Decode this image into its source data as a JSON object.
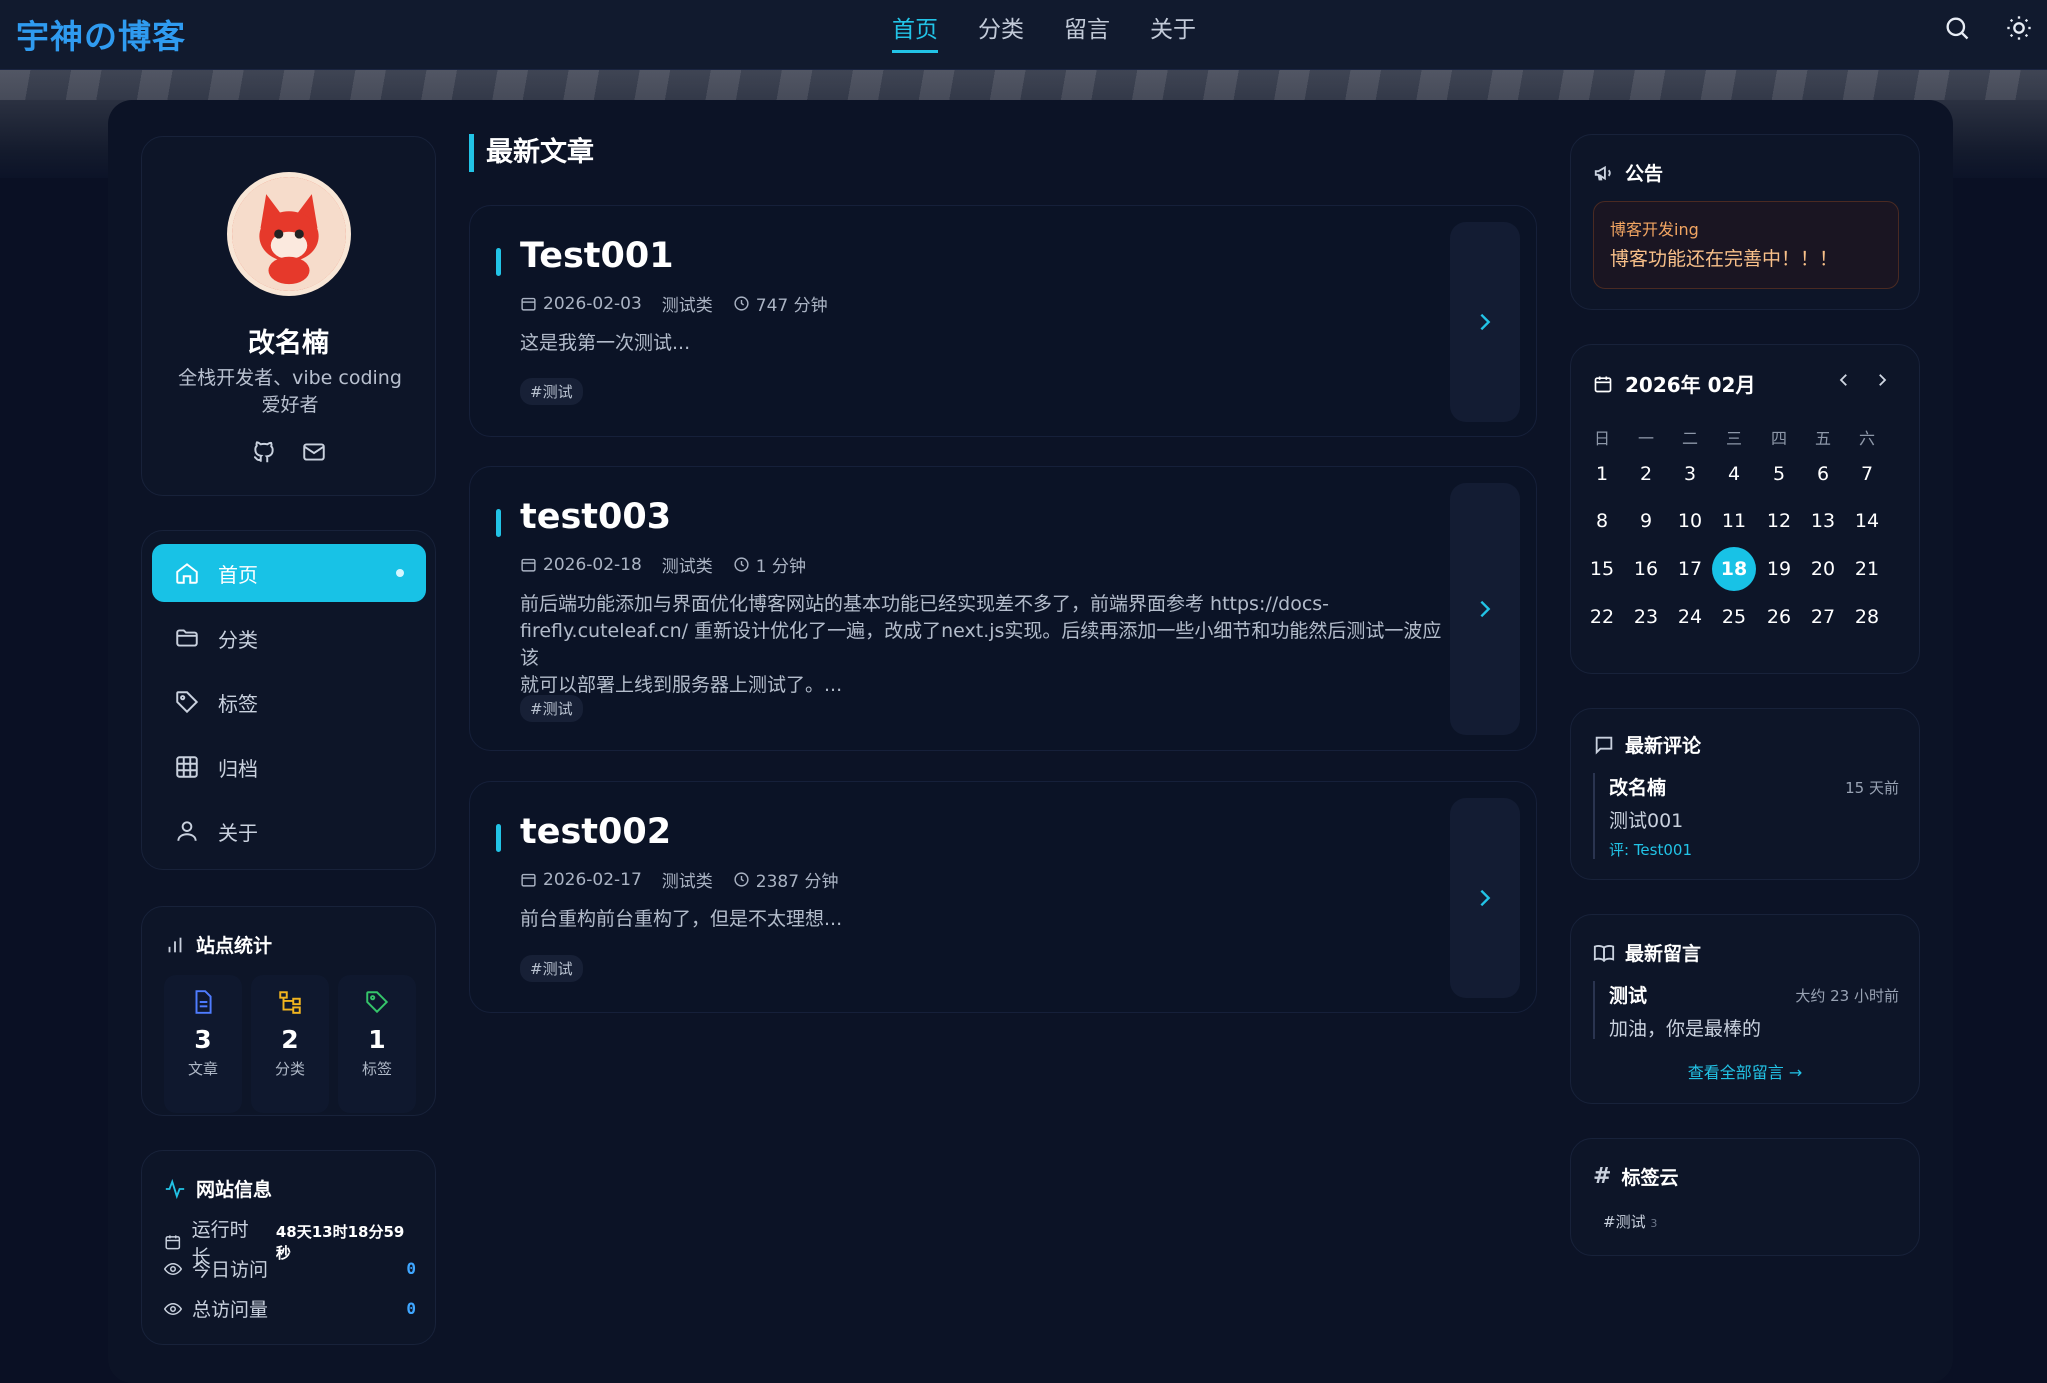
{
  "brand": {
    "logo": "宇神の博客"
  },
  "topnav": [
    {
      "label": "首页",
      "active": true
    },
    {
      "label": "分类",
      "active": false
    },
    {
      "label": "留言",
      "active": false
    },
    {
      "label": "关于",
      "active": false
    }
  ],
  "topicons": [
    "search-icon",
    "sun-icon"
  ],
  "profile": {
    "name": "改名楠",
    "bio_line1": "全栈开发者、vibe coding",
    "bio_line2": "爱好者",
    "social": [
      "github-icon",
      "mail-icon"
    ]
  },
  "sidemenu": [
    {
      "label": "首页",
      "icon": "home-icon",
      "active": true
    },
    {
      "label": "分类",
      "icon": "folder-icon",
      "active": false
    },
    {
      "label": "标签",
      "icon": "tag-icon",
      "active": false
    },
    {
      "label": "归档",
      "icon": "grid-icon",
      "active": false
    },
    {
      "label": "关于",
      "icon": "user-icon",
      "active": false
    }
  ],
  "stats": {
    "title": "站点统计",
    "items": [
      {
        "value": "3",
        "label": "文章",
        "color": "#4f7cff"
      },
      {
        "value": "2",
        "label": "分类",
        "color": "#f1b41f"
      },
      {
        "value": "1",
        "label": "标签",
        "color": "#35c46a"
      }
    ]
  },
  "siteinfo": {
    "title": "网站信息",
    "runtime_label": "运行时长",
    "runtime_value": "48天13时18分59秒",
    "today_label": "今日访问",
    "today_value": "0",
    "total_label": "总访问量",
    "total_value": "0"
  },
  "main": {
    "section_title": "最新文章",
    "posts": [
      {
        "title": "Test001",
        "date": "2026-02-03",
        "category": "测试类",
        "read": "747 分钟",
        "excerpt": "这是我第一次测试...",
        "tag": "#测试"
      },
      {
        "title": "test003",
        "date": "2026-02-18",
        "category": "测试类",
        "read": "1 分钟",
        "excerpt_line1": "前后端功能添加与界面优化博客网站的基本功能已经实现差不多了，前端界面参考 https://docs-",
        "excerpt_line2": "firefly.cuteleaf.cn/ 重新设计优化了一遍，改成了next.js实现。后续再添加一些小细节和功能然后测试一波应该",
        "excerpt_line3": "就可以部署上线到服务器上测试了。...",
        "tag": "#测试"
      },
      {
        "title": "test002",
        "date": "2026-02-17",
        "category": "测试类",
        "read": "2387 分钟",
        "excerpt": "前台重构前台重构了，但是不太理想...",
        "tag": "#测试"
      }
    ]
  },
  "notice": {
    "title": "公告",
    "line1": "博客开发ing",
    "line2": "博客功能还在完善中！！！"
  },
  "calendar": {
    "title": "2026年 02月",
    "weekdays": [
      "日",
      "一",
      "二",
      "三",
      "四",
      "五",
      "六"
    ],
    "today": "18",
    "weeks": [
      [
        "1",
        "2",
        "3",
        "4",
        "5",
        "6",
        "7"
      ],
      [
        "8",
        "9",
        "10",
        "11",
        "12",
        "13",
        "14"
      ],
      [
        "15",
        "16",
        "17",
        "18",
        "19",
        "20",
        "21"
      ],
      [
        "22",
        "23",
        "24",
        "25",
        "26",
        "27",
        "28"
      ]
    ]
  },
  "comments": {
    "title": "最新评论",
    "author": "改名楠",
    "time": "15 天前",
    "text": "测试001",
    "ref": "评: Test001"
  },
  "guestbook": {
    "title": "最新留言",
    "author": "测试",
    "time": "大约 23 小时前",
    "text": "加油，你是最棒的",
    "view_all": "查看全部留言 →"
  },
  "tagcloud": {
    "title": "标签云",
    "tags": [
      {
        "name": "#测试",
        "count": "3"
      }
    ]
  },
  "accent": "#22c3e6"
}
